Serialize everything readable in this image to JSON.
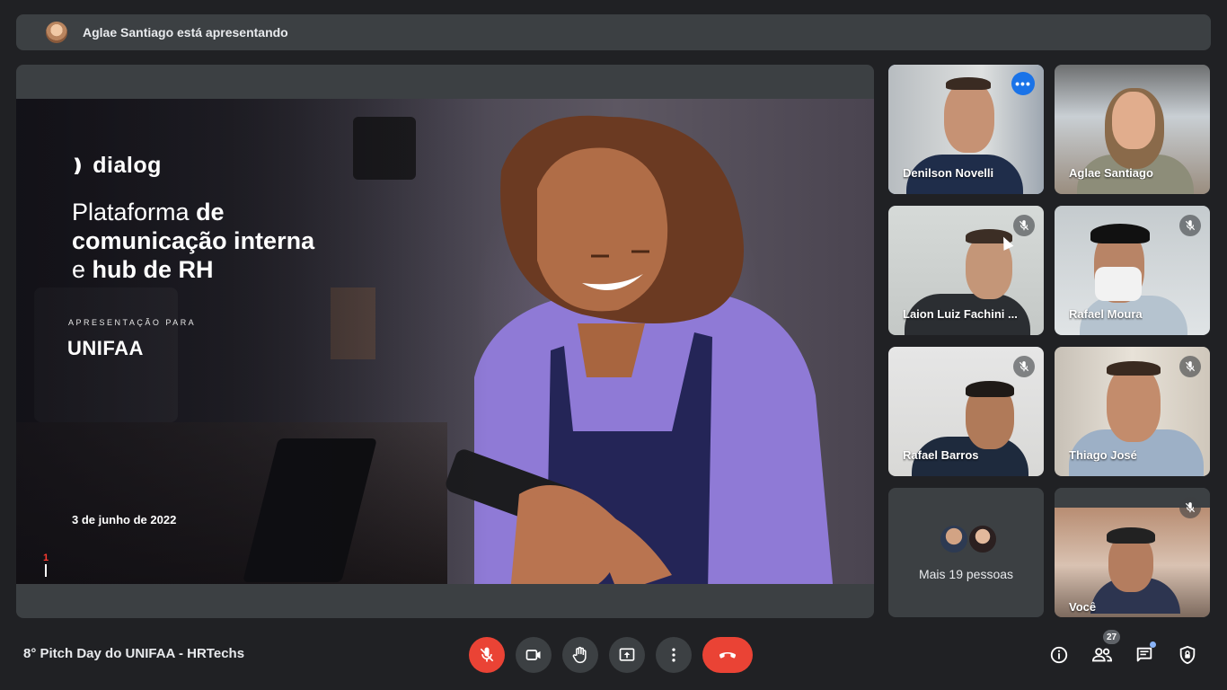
{
  "banner": {
    "presenter_text": "Aglae Santiago está apresentando"
  },
  "slide": {
    "logo_text": "dialog",
    "headline": {
      "l1_light": "Plataforma ",
      "l1_bold": "de",
      "l2_bold": "comunicação interna",
      "l3_light": "e ",
      "l3_bold": "hub de RH"
    },
    "kicker": "APRESENTAÇÃO PARA",
    "client": "UNIFAA",
    "date": "3 de junho de 2022",
    "slide_number": "1"
  },
  "participants": [
    {
      "name": "Denilson Novelli",
      "muted": false,
      "active": true
    },
    {
      "name": "Aglae Santiago",
      "muted": false
    },
    {
      "name": "Laion Luiz Fachini ...",
      "muted": true
    },
    {
      "name": "Rafael Moura",
      "muted": true
    },
    {
      "name": "Rafael Barros",
      "muted": true
    },
    {
      "name": "Thiago José",
      "muted": true
    },
    {
      "name": "Você",
      "muted": true
    }
  ],
  "more_people": {
    "label": "Mais 19 pessoas"
  },
  "bottom": {
    "meeting_title": "8° Pitch Day do UNIFAA - HRTechs",
    "participant_count": "27"
  },
  "colors": {
    "accent": "#8ab4f8",
    "danger": "#ea4335",
    "surface": "#3c4043",
    "background": "#202124"
  },
  "icons": [
    "mic-off-icon",
    "camera-icon",
    "raise-hand-icon",
    "present-icon",
    "more-vert-icon",
    "end-call-icon",
    "info-icon",
    "people-icon",
    "chat-icon",
    "lock-shield-icon"
  ]
}
